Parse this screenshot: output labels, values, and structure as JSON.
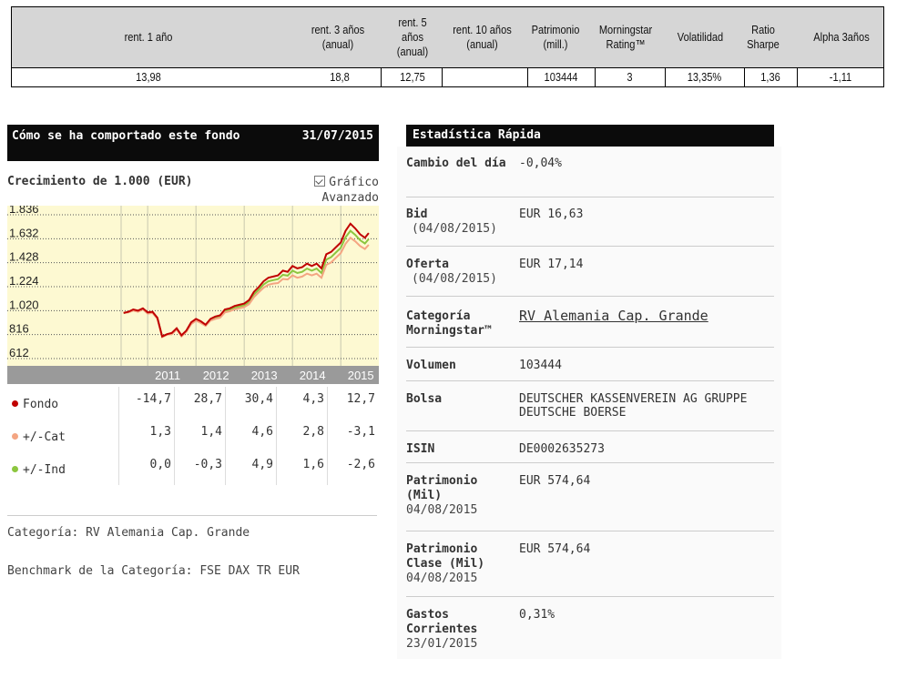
{
  "top_table": {
    "headers": [
      "rent. 1 año",
      "rent. 3 años\n(anual)",
      "rent. 5\naños\n(anual)",
      "rent. 10 años\n(anual)",
      "Patrimonio\n(mill.)",
      "Morningstar\nRating™",
      "Volatilidad",
      "Ratio\nSharpe",
      "Alpha 3años"
    ],
    "values": [
      "13,98",
      "18,8",
      "12,75",
      "",
      "103444",
      "3",
      "13,35%",
      "1,36",
      "-1,11"
    ]
  },
  "performance_panel": {
    "title": "Cómo se ha comportado este fondo",
    "date": "31/07/2015",
    "growth_title": "Crecimiento de 1.000 (EUR)",
    "advanced_chart_label": "Gráfico\nAvanzado",
    "rows": [
      {
        "label": "Fondo",
        "color": "#c00000",
        "values": [
          "-14,7",
          "28,7",
          "30,4",
          "4,3",
          "12,7"
        ]
      },
      {
        "label": "+/-Cat",
        "color": "#f4a582",
        "values": [
          "1,3",
          "1,4",
          "4,6",
          "2,8",
          "-3,1"
        ]
      },
      {
        "label": "+/-Ind",
        "color": "#8cc63f",
        "values": [
          "0,0",
          "-0,3",
          "4,9",
          "1,6",
          "-2,6"
        ]
      }
    ],
    "category_line": "Categoría: RV Alemania Cap. Grande",
    "benchmark_line": "Benchmark de la Categoría: FSE DAX TR EUR"
  },
  "chart_data": {
    "type": "line",
    "y_tick_labels": [
      "1.836",
      "1.632",
      "1.428",
      "1.224",
      "1.020",
      "816",
      "612"
    ],
    "x_tick_labels": [
      "2011",
      "2012",
      "2013",
      "2014",
      "2015"
    ],
    "ylim": [
      612,
      1836
    ],
    "x": [
      2010.5,
      2010.6,
      2010.7,
      2010.8,
      2010.9,
      2011.0,
      2011.1,
      2011.2,
      2011.3,
      2011.4,
      2011.5,
      2011.6,
      2011.7,
      2011.8,
      2011.9,
      2012.0,
      2012.1,
      2012.2,
      2012.3,
      2012.4,
      2012.5,
      2012.6,
      2012.7,
      2012.8,
      2012.9,
      2013.0,
      2013.1,
      2013.2,
      2013.3,
      2013.4,
      2013.5,
      2013.6,
      2013.7,
      2013.8,
      2013.9,
      2014.0,
      2014.1,
      2014.2,
      2014.3,
      2014.4,
      2014.5,
      2014.6,
      2014.7,
      2014.8,
      2014.9,
      2015.0,
      2015.1,
      2015.2,
      2015.3,
      2015.4,
      2015.5,
      2015.58
    ],
    "series": [
      {
        "name": "Fondo",
        "color": "#c00000",
        "values": [
          1000,
          1010,
          1030,
          1020,
          1040,
          1005,
          1010,
          960,
          800,
          820,
          830,
          870,
          810,
          850,
          920,
          950,
          930,
          900,
          950,
          970,
          980,
          1030,
          1040,
          1060,
          1070,
          1080,
          1110,
          1180,
          1220,
          1270,
          1300,
          1310,
          1320,
          1360,
          1350,
          1400,
          1380,
          1390,
          1420,
          1400,
          1420,
          1380,
          1500,
          1520,
          1560,
          1600,
          1700,
          1760,
          1720,
          1670,
          1640,
          1680
        ]
      },
      {
        "name": "+/-Cat",
        "color": "#f4a582",
        "values": [
          1000,
          1005,
          1020,
          1010,
          1030,
          995,
          1000,
          950,
          795,
          815,
          820,
          860,
          800,
          840,
          905,
          935,
          915,
          890,
          935,
          950,
          960,
          1005,
          1015,
          1030,
          1040,
          1050,
          1075,
          1135,
          1175,
          1215,
          1240,
          1250,
          1255,
          1290,
          1285,
          1320,
          1300,
          1310,
          1335,
          1320,
          1335,
          1300,
          1410,
          1430,
          1470,
          1510,
          1590,
          1640,
          1610,
          1570,
          1545,
          1580
        ]
      },
      {
        "name": "+/-Ind",
        "color": "#8cc63f",
        "values": [
          1000,
          1007,
          1025,
          1015,
          1035,
          1000,
          1005,
          955,
          798,
          818,
          825,
          865,
          805,
          845,
          912,
          942,
          922,
          895,
          942,
          960,
          970,
          1018,
          1028,
          1045,
          1055,
          1065,
          1092,
          1158,
          1198,
          1242,
          1270,
          1280,
          1288,
          1325,
          1318,
          1360,
          1340,
          1350,
          1378,
          1360,
          1378,
          1340,
          1455,
          1475,
          1515,
          1555,
          1645,
          1700,
          1665,
          1620,
          1592,
          1630
        ]
      }
    ]
  },
  "quick_stats": {
    "title": "Estadística Rápida",
    "rows": [
      {
        "label": "Cambio del día",
        "sub": "",
        "value": "-0,04%",
        "link": false
      },
      {
        "label": "Bid",
        "sub": "(04/08/2015)",
        "value": "EUR 16,63",
        "link": false
      },
      {
        "label": "Oferta",
        "sub": "(04/08/2015)",
        "value": "EUR 17,14",
        "link": false
      },
      {
        "label": "Categoría Morningstar™",
        "sub": "",
        "value": "RV Alemania Cap. Grande",
        "link": true
      },
      {
        "label": "Volumen",
        "sub": "",
        "value": "103444",
        "link": false
      },
      {
        "label": "Bolsa",
        "sub": "",
        "value": "DEUTSCHER KASSENVEREIN AG GRUPPE DEUTSCHE BOERSE",
        "link": false
      },
      {
        "label": "ISIN",
        "sub": "",
        "value": "DE0002635273",
        "link": false
      },
      {
        "label": "Patrimonio (Mil)",
        "sub": "04/08/2015",
        "value": "EUR 574,64",
        "link": false
      },
      {
        "label": "Patrimonio Clase (Mil)",
        "sub": "04/08/2015",
        "value": "EUR 574,64",
        "link": false
      },
      {
        "label": "Gastos Corrientes",
        "sub": "23/01/2015",
        "value": "0,31%",
        "link": false
      }
    ]
  }
}
